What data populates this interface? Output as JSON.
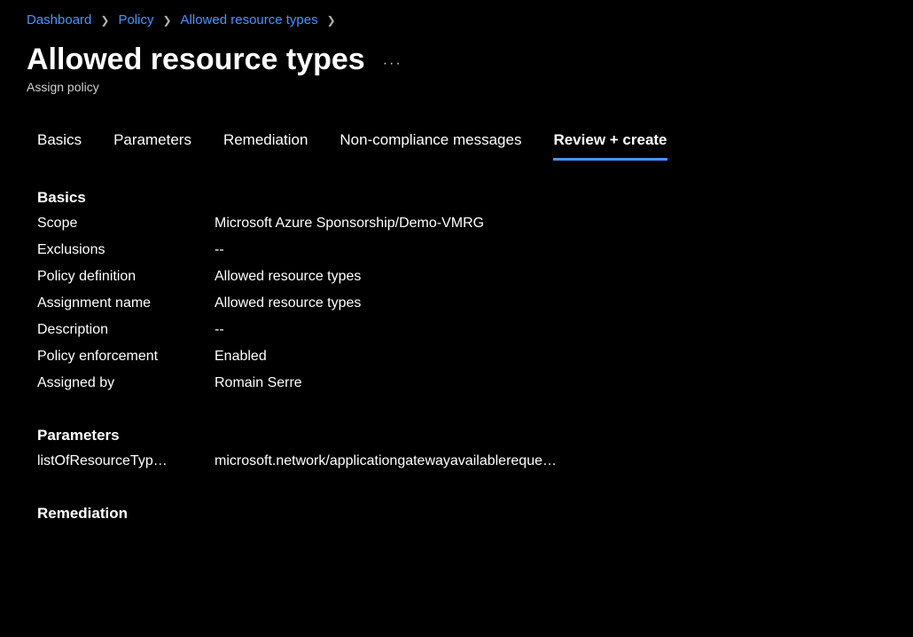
{
  "breadcrumb": {
    "items": [
      {
        "label": "Dashboard"
      },
      {
        "label": "Policy"
      },
      {
        "label": "Allowed resource types"
      }
    ]
  },
  "header": {
    "title": "Allowed resource types",
    "subtitle": "Assign policy"
  },
  "tabs": {
    "items": [
      {
        "label": "Basics"
      },
      {
        "label": "Parameters"
      },
      {
        "label": "Remediation"
      },
      {
        "label": "Non-compliance messages"
      },
      {
        "label": "Review + create"
      }
    ]
  },
  "sections": {
    "basics": {
      "heading": "Basics",
      "rows": {
        "scope": {
          "label": "Scope",
          "value": "Microsoft Azure Sponsorship/Demo-VMRG"
        },
        "exclusions": {
          "label": "Exclusions",
          "value": "--"
        },
        "policyDefinition": {
          "label": "Policy definition",
          "value": "Allowed resource types"
        },
        "assignmentName": {
          "label": "Assignment name",
          "value": "Allowed resource types"
        },
        "description": {
          "label": "Description",
          "value": "--"
        },
        "policyEnforcement": {
          "label": "Policy enforcement",
          "value": "Enabled"
        },
        "assignedBy": {
          "label": "Assigned by",
          "value": "Romain Serre"
        }
      }
    },
    "parameters": {
      "heading": "Parameters",
      "rows": {
        "listOfResourceTypes": {
          "label": "listOfResourceTyp…",
          "value": "microsoft.network/applicationgatewayavailablereque…"
        }
      }
    },
    "remediation": {
      "heading": "Remediation"
    }
  }
}
